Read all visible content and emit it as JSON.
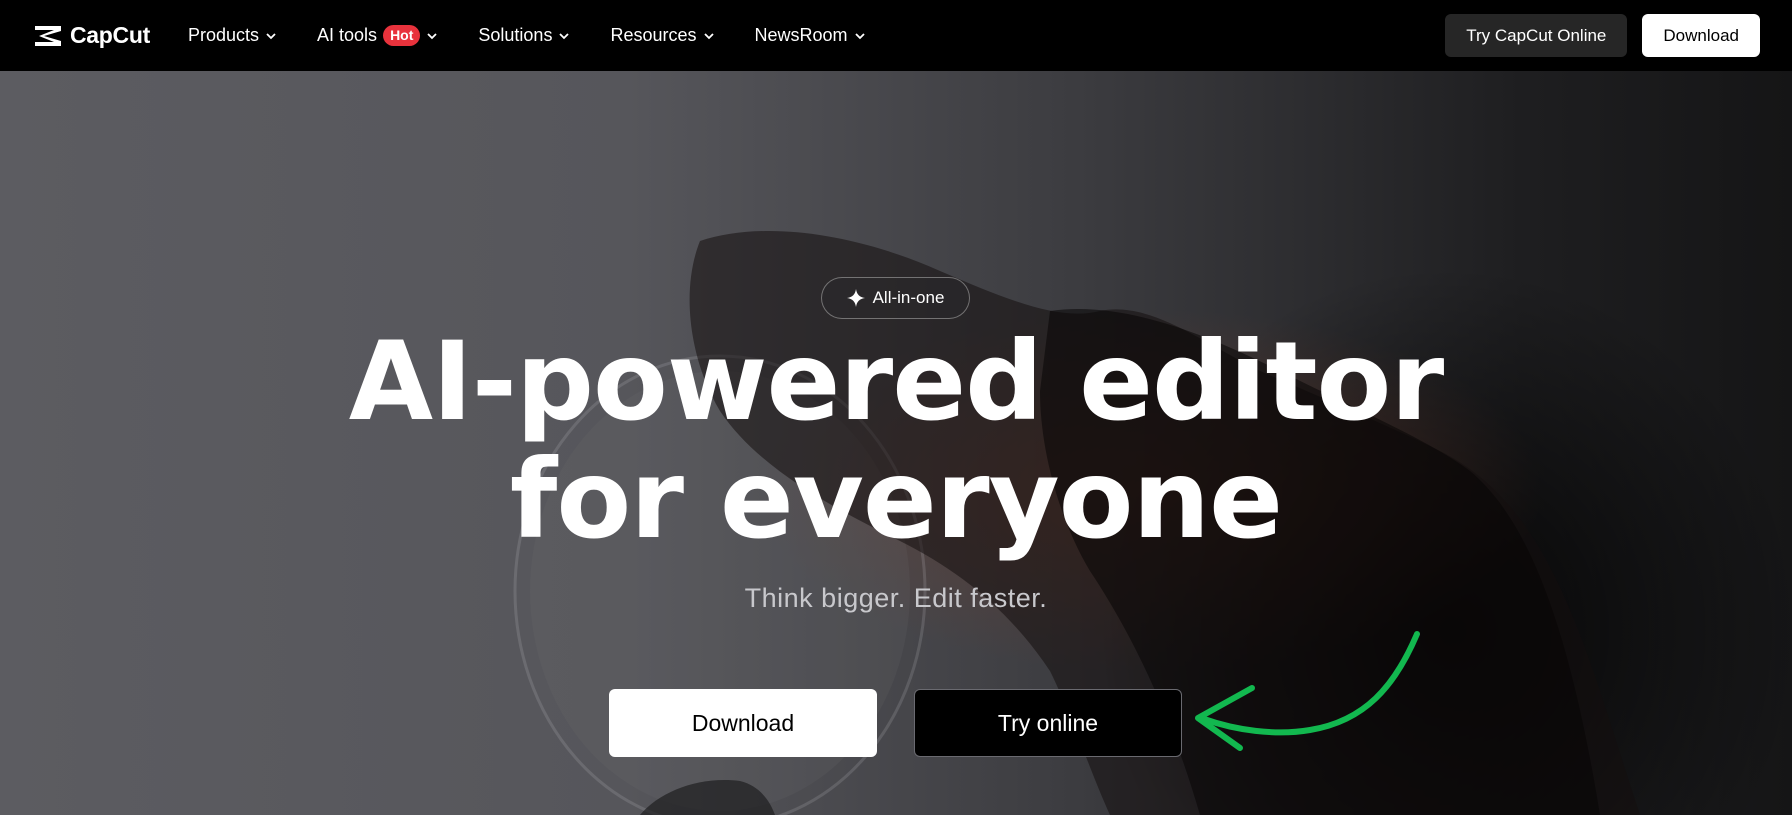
{
  "brand": {
    "name": "CapCut"
  },
  "nav": {
    "items": [
      {
        "label": "Products"
      },
      {
        "label": "AI tools",
        "badge": "Hot"
      },
      {
        "label": "Solutions"
      },
      {
        "label": "Resources"
      },
      {
        "label": "NewsRoom"
      }
    ],
    "try_online_label": "Try CapCut Online",
    "download_label": "Download"
  },
  "hero": {
    "pill_label": "All-in-one",
    "headline_line1": "AI-powered editor",
    "headline_line2": "for everyone",
    "subline": "Think bigger. Edit faster.",
    "download_label": "Download",
    "try_label": "Try online"
  },
  "colors": {
    "hot_badge": "#e8323c",
    "annotation_arrow": "#12b84f",
    "nav_background": "#000000"
  },
  "icons": {
    "logo": "capcut-logo-icon",
    "chevron": "chevron-down-icon",
    "sparkle": "sparkle-icon",
    "annotation": "curved-arrow-icon"
  }
}
